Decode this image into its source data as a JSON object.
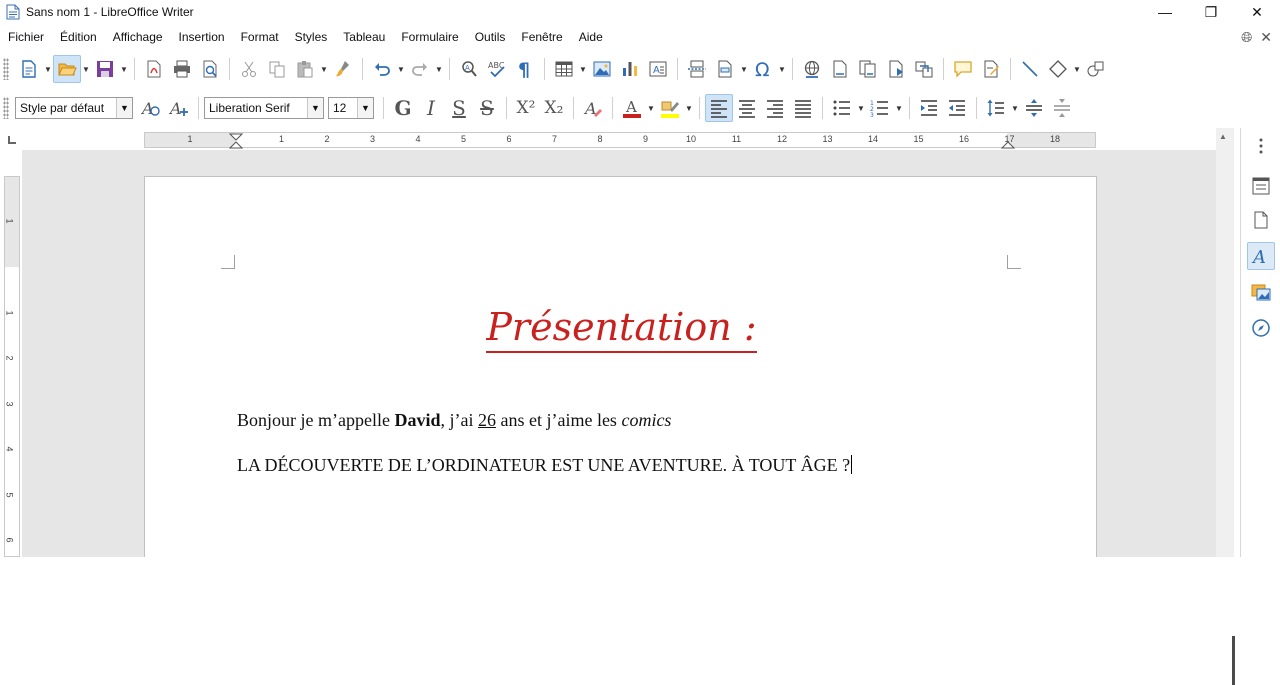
{
  "window": {
    "title": "Sans nom 1 - LibreOffice Writer",
    "minimize": "—",
    "restore": "❐",
    "close": "✕"
  },
  "menu": [
    "Fichier",
    "Édition",
    "Affichage",
    "Insertion",
    "Format",
    "Styles",
    "Tableau",
    "Formulaire",
    "Outils",
    "Fenêtre",
    "Aide"
  ],
  "formatting": {
    "paragraph_style": "Style par défaut",
    "font_name": "Liberation Serif",
    "font_size": "12",
    "bold_glyph": "G",
    "italic_glyph": "I",
    "underline_glyph": "S",
    "strike_glyph": "S",
    "superscript_glyph": "X²",
    "subscript_glyph": "X₂",
    "font_color": "#c9211e",
    "highlight_color": "#ffff00"
  },
  "ruler": {
    "h_labels": [
      "1",
      "1",
      "2",
      "3",
      "4",
      "5",
      "6",
      "7",
      "8",
      "9",
      "10",
      "11",
      "12",
      "13",
      "14",
      "15",
      "16",
      "17",
      "18"
    ],
    "v_labels": [
      "1",
      "1",
      "2",
      "3",
      "4",
      "5",
      "6"
    ]
  },
  "document": {
    "title": "Présentation :",
    "title_color": "#c9211e",
    "para1": {
      "before_name": "Bonjour je m’appelle ",
      "name": "David",
      "middle": ", j’ai ",
      "age": "26",
      "after_age": " ans et j’aime les ",
      "hobby": "comics"
    },
    "para2": "LA DÉCOUVERTE DE L’ORDINATEUR EST UNE AVENTURE. À TOUT ÂGE ?"
  }
}
